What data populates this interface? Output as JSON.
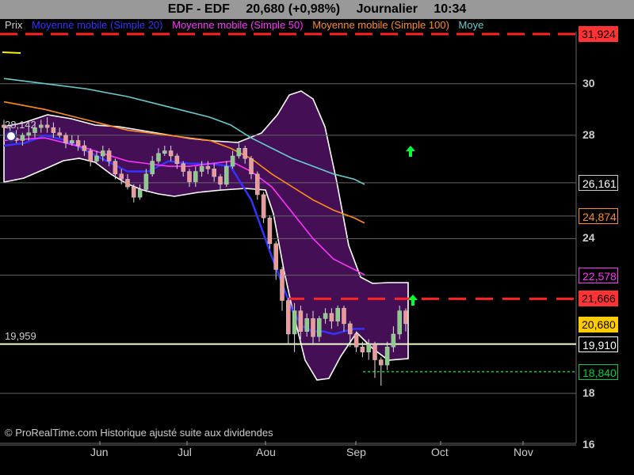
{
  "header": {
    "symbol": "EDF - EDF",
    "quote": "20,680 (+0,98%)",
    "period": "Journalier",
    "time": "10:34"
  },
  "legend": [
    {
      "label": "Prix",
      "color": "#cccccc"
    },
    {
      "label": "Moyenne mobile (Simple 20)",
      "color": "#3333ff"
    },
    {
      "label": "Moyenne mobile (Simple 50)",
      "color": "#ff33ff"
    },
    {
      "label": "Moyenne mobile (Simple 100)",
      "color": "#ff8c1a"
    },
    {
      "label": "Moye",
      "color": "#66cccc"
    }
  ],
  "copyright": "© ProRealTime.com Historique ajusté suite aux dividendes",
  "chart_data": {
    "type": "line",
    "ylim": [
      16,
      32
    ],
    "y_ticks": [
      "30",
      "28",
      "24",
      "18",
      "16"
    ],
    "x_months": [
      "Jun",
      "Jul",
      "Aou",
      "Sep",
      "Oct",
      "Nov"
    ],
    "price_labels": [
      {
        "text": "31,924",
        "value": 31.924,
        "bg": "#ff3333",
        "fg": "#000000"
      },
      {
        "text": "26,161",
        "value": 26.161,
        "bg": "#000000",
        "fg": "#ffffff",
        "border": "#cccccc"
      },
      {
        "text": "24,874",
        "value": 24.874,
        "bg": "#000000",
        "fg": "#ff8c1a",
        "border": "#ff8c1a"
      },
      {
        "text": "22,578",
        "value": 22.578,
        "bg": "#000000",
        "fg": "#ff33ff",
        "border": "#ff33ff"
      },
      {
        "text": "21,666",
        "value": 21.666,
        "bg": "#ff3333",
        "fg": "#000000"
      },
      {
        "text": "20,680",
        "value": 20.68,
        "bg": "#ffcc00",
        "fg": "#000000"
      },
      {
        "text": "19,910",
        "value": 19.91,
        "bg": "#000000",
        "fg": "#ffffff",
        "border": "#ffffff"
      },
      {
        "text": "18,840",
        "value": 18.84,
        "bg": "#000000",
        "fg": "#00cc44",
        "border": "#00cc44"
      }
    ],
    "inline_labels": [
      {
        "text": "28,142",
        "value": 28.142
      },
      {
        "text": "19,959",
        "value": 19.959
      }
    ],
    "horizontal_levels": [
      31.924,
      21.666,
      19.91,
      18.84
    ],
    "series": [
      {
        "name": "Moyenne mobile (Simple 20)",
        "color": "#3333ff",
        "x": [
          0,
          10,
          20,
          30,
          40,
          50,
          60,
          70,
          80,
          90,
          100,
          110,
          120,
          130,
          140,
          145,
          150,
          155,
          160,
          165,
          170,
          175
        ],
        "y": [
          27.6,
          27.7,
          28.0,
          27.8,
          27.4,
          27.0,
          26.6,
          26.6,
          27.0,
          26.9,
          26.9,
          26.8,
          25.5,
          23.3,
          21.2,
          20.6,
          20.4,
          20.4,
          20.3,
          20.4,
          20.5,
          20.5
        ]
      },
      {
        "name": "Moyenne mobile (Simple 50)",
        "color": "#ff33ff",
        "x": [
          0,
          20,
          40,
          60,
          80,
          90,
          100,
          110,
          120,
          130,
          140,
          150,
          160,
          170,
          175
        ],
        "y": [
          27.8,
          27.9,
          27.5,
          27.0,
          26.8,
          26.8,
          26.9,
          27.0,
          26.6,
          26.0,
          25.0,
          24.0,
          23.2,
          22.8,
          22.6
        ]
      },
      {
        "name": "Moyenne mobile (Simple 100)",
        "color": "#ff8c1a",
        "x": [
          0,
          20,
          40,
          60,
          80,
          100,
          110,
          120,
          130,
          140,
          150,
          160,
          170,
          175
        ],
        "y": [
          29.3,
          29.0,
          28.6,
          28.2,
          28.0,
          27.8,
          27.5,
          27.1,
          26.5,
          26.0,
          25.5,
          25.1,
          24.8,
          24.6
        ]
      },
      {
        "name": "Moye",
        "color": "#66cccc",
        "x": [
          0,
          20,
          40,
          60,
          80,
          100,
          110,
          120,
          130,
          140,
          150,
          160,
          170,
          175
        ],
        "y": [
          30.2,
          30.0,
          29.8,
          29.5,
          29.1,
          28.7,
          28.4,
          27.9,
          27.5,
          27.1,
          26.8,
          26.5,
          26.3,
          26.1
        ]
      }
    ],
    "candles": [
      [
        0,
        28.4,
        28.3,
        28.6,
        27.9
      ],
      [
        3,
        28.1,
        28.0,
        28.4,
        27.8
      ],
      [
        6,
        27.9,
        27.8,
        28.2,
        27.7
      ],
      [
        9,
        27.8,
        28.0,
        28.1,
        27.6
      ],
      [
        12,
        28.0,
        28.1,
        28.3,
        27.8
      ],
      [
        15,
        28.1,
        28.3,
        28.5,
        27.9
      ],
      [
        18,
        28.3,
        28.4,
        28.6,
        28.1
      ],
      [
        21,
        28.4,
        28.3,
        28.7,
        28.1
      ],
      [
        24,
        28.3,
        28.1,
        28.5,
        27.9
      ],
      [
        27,
        28.1,
        28.0,
        28.3,
        27.9
      ],
      [
        30,
        28.0,
        27.7,
        28.1,
        27.5
      ],
      [
        33,
        27.7,
        27.8,
        28.0,
        27.6
      ],
      [
        36,
        27.8,
        27.6,
        28.0,
        27.4
      ],
      [
        39,
        27.6,
        27.4,
        27.8,
        27.2
      ],
      [
        42,
        27.4,
        27.0,
        27.5,
        26.8
      ],
      [
        45,
        27.0,
        27.2,
        27.4,
        26.9
      ],
      [
        48,
        27.2,
        27.4,
        27.6,
        27.0
      ],
      [
        51,
        27.4,
        27.0,
        27.5,
        26.8
      ],
      [
        54,
        27.0,
        26.5,
        27.1,
        26.3
      ],
      [
        57,
        26.5,
        26.3,
        26.7,
        26.1
      ],
      [
        60,
        26.3,
        26.0,
        26.5,
        25.9
      ],
      [
        63,
        26.0,
        25.6,
        26.1,
        25.4
      ],
      [
        66,
        25.6,
        25.9,
        26.1,
        25.5
      ],
      [
        69,
        25.9,
        26.5,
        26.7,
        25.8
      ],
      [
        72,
        26.5,
        27.0,
        27.2,
        26.4
      ],
      [
        75,
        27.0,
        27.3,
        27.5,
        26.9
      ],
      [
        78,
        27.3,
        27.4,
        27.6,
        27.2
      ],
      [
        81,
        27.4,
        27.2,
        27.6,
        27.0
      ],
      [
        84,
        27.2,
        26.9,
        27.3,
        26.7
      ],
      [
        87,
        26.9,
        26.6,
        27.0,
        26.4
      ],
      [
        90,
        26.6,
        26.2,
        26.7,
        26.0
      ],
      [
        93,
        26.2,
        26.6,
        26.8,
        26.0
      ],
      [
        96,
        26.6,
        26.8,
        27.0,
        26.4
      ],
      [
        99,
        26.8,
        26.7,
        27.0,
        26.5
      ],
      [
        102,
        26.7,
        26.4,
        26.9,
        26.2
      ],
      [
        105,
        26.4,
        26.1,
        26.5,
        25.9
      ],
      [
        108,
        26.1,
        26.8,
        27.0,
        26.0
      ],
      [
        111,
        26.8,
        27.2,
        27.4,
        26.7
      ],
      [
        114,
        27.2,
        27.5,
        27.7,
        27.1
      ],
      [
        117,
        27.5,
        27.1,
        27.6,
        26.9
      ],
      [
        120,
        27.1,
        26.5,
        27.2,
        26.3
      ],
      [
        123,
        26.5,
        25.7,
        26.6,
        25.5
      ],
      [
        126,
        25.7,
        24.8,
        25.8,
        24.6
      ],
      [
        129,
        24.8,
        23.8,
        24.9,
        23.6
      ],
      [
        132,
        23.8,
        22.8,
        23.9,
        22.4
      ],
      [
        135,
        22.8,
        21.6,
        22.9,
        21.2
      ],
      [
        138,
        21.6,
        20.3,
        21.7,
        19.9
      ],
      [
        141,
        20.3,
        21.2,
        21.5,
        19.6
      ],
      [
        144,
        21.2,
        20.4,
        21.4,
        20.1
      ],
      [
        147,
        20.4,
        20.9,
        21.1,
        20.2
      ],
      [
        150,
        20.9,
        20.2,
        21.2,
        19.9
      ],
      [
        153,
        20.2,
        20.9,
        21.0,
        20.0
      ],
      [
        156,
        20.9,
        21.1,
        21.3,
        20.7
      ],
      [
        159,
        21.1,
        20.8,
        21.3,
        20.5
      ],
      [
        162,
        20.8,
        21.3,
        21.4,
        20.6
      ],
      [
        165,
        21.3,
        20.7,
        21.4,
        20.4
      ],
      [
        168,
        20.7,
        20.3,
        20.8,
        19.8
      ],
      [
        171,
        20.3,
        19.8,
        20.4,
        19.6
      ],
      [
        174,
        19.8,
        19.6,
        20.0,
        19.4
      ],
      [
        177,
        19.6,
        19.9,
        20.1,
        19.3
      ],
      [
        180,
        19.9,
        19.3,
        20.0,
        18.6
      ],
      [
        183,
        19.3,
        19.1,
        19.4,
        18.3
      ],
      [
        186,
        19.1,
        19.8,
        20.0,
        18.9
      ],
      [
        189,
        19.8,
        20.3,
        20.6,
        19.6
      ],
      [
        192,
        20.3,
        21.2,
        21.4,
        20.1
      ],
      [
        195,
        21.2,
        20.7,
        21.3,
        20.4
      ]
    ]
  }
}
